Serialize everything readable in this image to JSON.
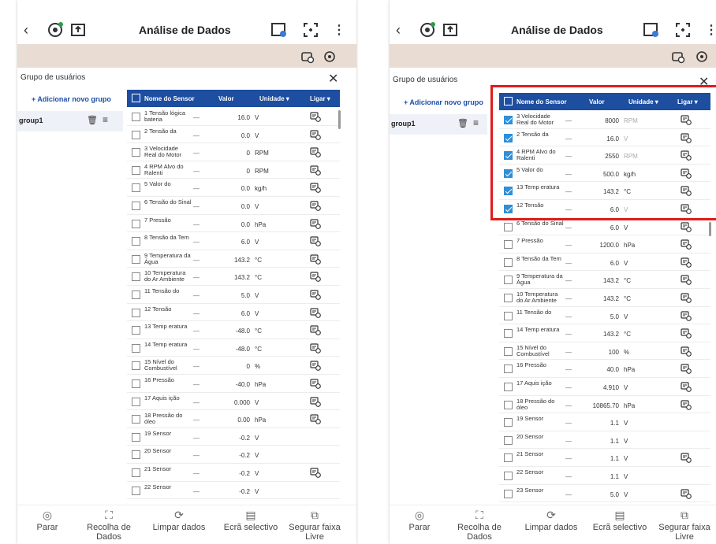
{
  "title": "Análise de Dados",
  "group_label": "Grupo de usuários",
  "add_group": "+ Adicionar novo grupo",
  "group_name": "group1",
  "columns": {
    "check": "",
    "name": "Nome do Sensor",
    "value": "Valor",
    "unit": "Unidade ▾",
    "link": "Ligar ▾"
  },
  "bottom_nav": [
    {
      "label": "Parar",
      "icon": "stop-icon"
    },
    {
      "label": "Recolha de Dados",
      "icon": "capture-icon"
    },
    {
      "label": "Limpar dados",
      "icon": "refresh-icon"
    },
    {
      "label": "Ecrã selectivo",
      "icon": "screen-icon"
    },
    {
      "label": "Segurar faixa Livre",
      "icon": "hold-icon"
    }
  ],
  "left_rows": [
    {
      "name": "1 Tensão lógica bateria",
      "value": "16.0",
      "unit": "V",
      "checked": false,
      "link": true
    },
    {
      "name": "2 Tensão da",
      "value": "0.0",
      "unit": "V",
      "checked": false,
      "link": true
    },
    {
      "name": "3 Velocidade Real do Motor",
      "value": "0",
      "unit": "RPM",
      "checked": false,
      "link": true
    },
    {
      "name": "4 RPM Alvo do Ralenti",
      "value": "0",
      "unit": "RPM",
      "checked": false,
      "link": true
    },
    {
      "name": "5 Valor do",
      "value": "0.0",
      "unit": "kg/h",
      "checked": false,
      "link": true
    },
    {
      "name": "6 Tensão do Sinal",
      "value": "0.0",
      "unit": "V",
      "checked": false,
      "link": true
    },
    {
      "name": "7 Pressão",
      "value": "0.0",
      "unit": "hPa",
      "checked": false,
      "link": true
    },
    {
      "name": "8 Tensão da Tem",
      "value": "6.0",
      "unit": "V",
      "checked": false,
      "link": true
    },
    {
      "name": "9 Temperatura da Água",
      "value": "143.2",
      "unit": "°C",
      "checked": false,
      "link": true
    },
    {
      "name": "10 Temperatura do Ar Ambiente",
      "value": "143.2",
      "unit": "°C",
      "checked": false,
      "link": true
    },
    {
      "name": "11 Tensão do",
      "value": "5.0",
      "unit": "V",
      "checked": false,
      "link": true
    },
    {
      "name": "12 Tensão",
      "value": "6.0",
      "unit": "V",
      "checked": false,
      "link": true
    },
    {
      "name": "13 Temp eratura",
      "value": "-48.0",
      "unit": "°C",
      "checked": false,
      "link": true
    },
    {
      "name": "14 Temp eratura",
      "value": "-48.0",
      "unit": "°C",
      "checked": false,
      "link": true
    },
    {
      "name": "15 Nível do Combustível",
      "value": "0",
      "unit": "%",
      "checked": false,
      "link": true
    },
    {
      "name": "16 Pressão",
      "value": "-40.0",
      "unit": "hPa",
      "checked": false,
      "link": true
    },
    {
      "name": "17 Aquis ição",
      "value": "0.000",
      "unit": "V",
      "checked": false,
      "link": true
    },
    {
      "name": "18 Pressão do óleo",
      "value": "0.00",
      "unit": "hPa",
      "checked": false,
      "link": true
    },
    {
      "name": "19 Sensor",
      "value": "-0.2",
      "unit": "V",
      "checked": false,
      "link": false
    },
    {
      "name": "20 Sensor",
      "value": "-0.2",
      "unit": "V",
      "checked": false,
      "link": false
    },
    {
      "name": "21 Sensor",
      "value": "-0.2",
      "unit": "V",
      "checked": false,
      "link": true
    },
    {
      "name": "22 Sensor",
      "value": "-0.2",
      "unit": "V",
      "checked": false,
      "link": false
    }
  ],
  "right_rows": [
    {
      "name": "3 Velocidade Real do Motor",
      "value": "8000",
      "unit": "RPM",
      "checked": true,
      "link": true,
      "grey": true
    },
    {
      "name": "2 Tensão da",
      "value": "16.0",
      "unit": "V",
      "checked": true,
      "link": true,
      "grey": true
    },
    {
      "name": "4 RPM Alvo do Ralenti",
      "value": "2550",
      "unit": "RPM",
      "checked": true,
      "link": true,
      "grey": true
    },
    {
      "name": "5 Valor do",
      "value": "500.0",
      "unit": "kg/h",
      "checked": true,
      "link": true
    },
    {
      "name": "13 Temp eratura",
      "value": "143.2",
      "unit": "°C",
      "checked": true,
      "link": true
    },
    {
      "name": "12 Tensão",
      "value": "6.0",
      "unit": "V",
      "checked": true,
      "link": true,
      "grey": true
    },
    {
      "name": "6 Tensão do Sinal",
      "value": "6.0",
      "unit": "V",
      "checked": false,
      "link": true
    },
    {
      "name": "7 Pressão",
      "value": "1200.0",
      "unit": "hPa",
      "checked": false,
      "link": true
    },
    {
      "name": "8 Tensão da Tem",
      "value": "6.0",
      "unit": "V",
      "checked": false,
      "link": true
    },
    {
      "name": "9 Temperatura da Água",
      "value": "143.2",
      "unit": "°C",
      "checked": false,
      "link": true
    },
    {
      "name": "10 Temperatura do Ar Ambiente",
      "value": "143.2",
      "unit": "°C",
      "checked": false,
      "link": true
    },
    {
      "name": "11 Tensão do",
      "value": "5.0",
      "unit": "V",
      "checked": false,
      "link": true
    },
    {
      "name": "14 Temp eratura",
      "value": "143.2",
      "unit": "°C",
      "checked": false,
      "link": true
    },
    {
      "name": "15 Nível do Combustível",
      "value": "100",
      "unit": "%",
      "checked": false,
      "link": true
    },
    {
      "name": "16 Pressão",
      "value": "40.0",
      "unit": "hPa",
      "checked": false,
      "link": true
    },
    {
      "name": "17 Aquis ição",
      "value": "4.910",
      "unit": "V",
      "checked": false,
      "link": true
    },
    {
      "name": "18 Pressão do óleo",
      "value": "10865.70",
      "unit": "hPa",
      "checked": false,
      "link": true
    },
    {
      "name": "19 Sensor",
      "value": "1.1",
      "unit": "V",
      "checked": false,
      "link": false
    },
    {
      "name": "20 Sensor",
      "value": "1.1",
      "unit": "V",
      "checked": false,
      "link": false
    },
    {
      "name": "21 Sensor",
      "value": "1.1",
      "unit": "V",
      "checked": false,
      "link": true
    },
    {
      "name": "22 Sensor",
      "value": "1.1",
      "unit": "V",
      "checked": false,
      "link": false
    },
    {
      "name": "23 Sensor",
      "value": "5.0",
      "unit": "V",
      "checked": false,
      "link": true
    }
  ]
}
